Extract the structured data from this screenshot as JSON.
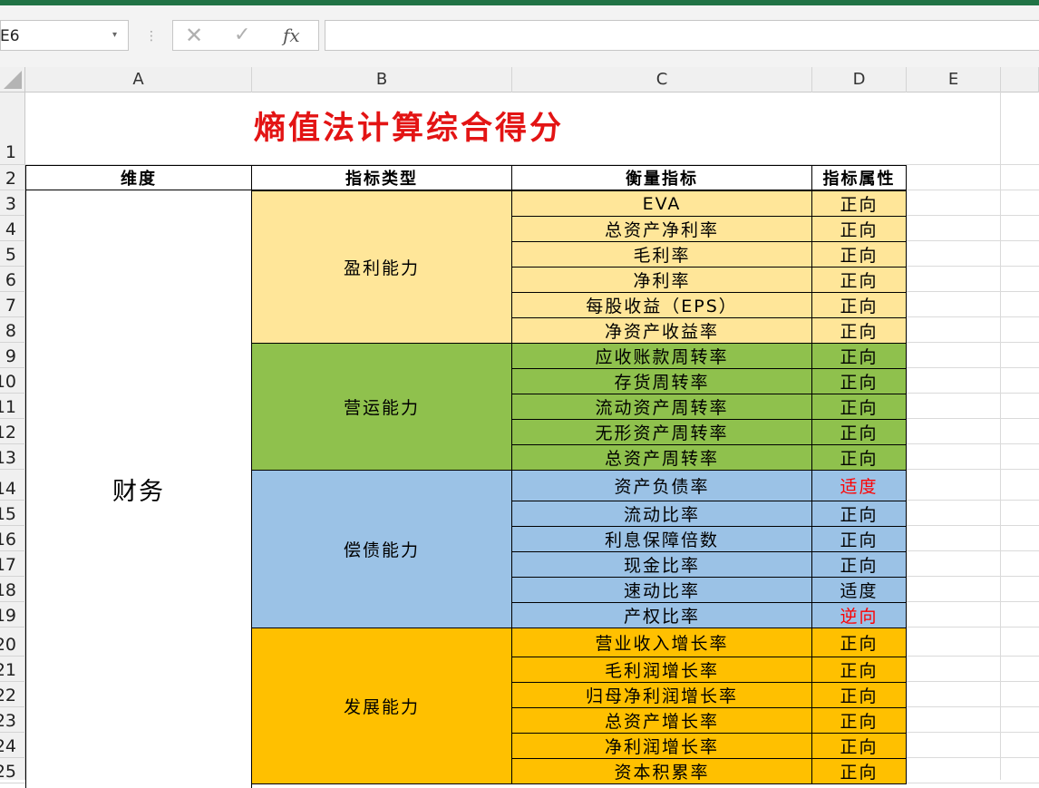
{
  "formula_bar": {
    "name_box": "E6",
    "cancel_icon": "✕",
    "enter_icon": "✓",
    "fx_label": "fx",
    "formula": ""
  },
  "columns": [
    "A",
    "B",
    "C",
    "D",
    "E"
  ],
  "rows": [
    "1",
    "2",
    "3",
    "4",
    "5",
    "6",
    "7",
    "8",
    "9",
    "10",
    "11",
    "12",
    "13",
    "14",
    "15",
    "16",
    "17",
    "18",
    "19",
    "20",
    "21",
    "22",
    "23",
    "24",
    "25"
  ],
  "sheet": {
    "title": "熵值法计算综合得分",
    "headers": {
      "dimension": "维度",
      "type": "指标类型",
      "metric": "衡量指标",
      "attribute": "指标属性"
    },
    "dimension": "财务",
    "groups": [
      {
        "type": "盈利能力",
        "color": "#ffe699",
        "items": [
          {
            "metric": "EVA",
            "attr": "正向"
          },
          {
            "metric": "总资产净利率",
            "attr": "正向"
          },
          {
            "metric": "毛利率",
            "attr": "正向"
          },
          {
            "metric": "净利率",
            "attr": "正向"
          },
          {
            "metric": "每股收益（EPS）",
            "attr": "正向"
          },
          {
            "metric": "净资产收益率",
            "attr": "正向"
          }
        ]
      },
      {
        "type": "营运能力",
        "color": "#8fc14d",
        "items": [
          {
            "metric": "应收账款周转率",
            "attr": "正向"
          },
          {
            "metric": "存货周转率",
            "attr": "正向"
          },
          {
            "metric": "流动资产周转率",
            "attr": "正向"
          },
          {
            "metric": "无形资产周转率",
            "attr": "正向"
          },
          {
            "metric": "总资产周转率",
            "attr": "正向"
          }
        ]
      },
      {
        "type": "偿债能力",
        "color": "#9bc2e6",
        "items": [
          {
            "metric": "资产负债率",
            "attr": "适度",
            "attr_color": "#ff0000"
          },
          {
            "metric": "流动比率",
            "attr": "正向"
          },
          {
            "metric": "利息保障倍数",
            "attr": "正向"
          },
          {
            "metric": "现金比率",
            "attr": "正向"
          },
          {
            "metric": "速动比率",
            "attr": "适度"
          },
          {
            "metric": "产权比率",
            "attr": "逆向",
            "attr_color": "#ff0000"
          }
        ]
      },
      {
        "type": "发展能力",
        "color": "#ffc000",
        "items": [
          {
            "metric": "营业收入增长率",
            "attr": "正向"
          },
          {
            "metric": "毛利润增长率",
            "attr": "正向"
          },
          {
            "metric": "归母净利润增长率",
            "attr": "正向"
          },
          {
            "metric": "总资产增长率",
            "attr": "正向"
          },
          {
            "metric": "净利润增长率",
            "attr": "正向"
          },
          {
            "metric": "资本积累率",
            "attr": "正向"
          }
        ]
      }
    ]
  },
  "colors": {
    "title_red": "#e31414",
    "excel_green": "#217346",
    "warning_red": "#ff0000"
  }
}
